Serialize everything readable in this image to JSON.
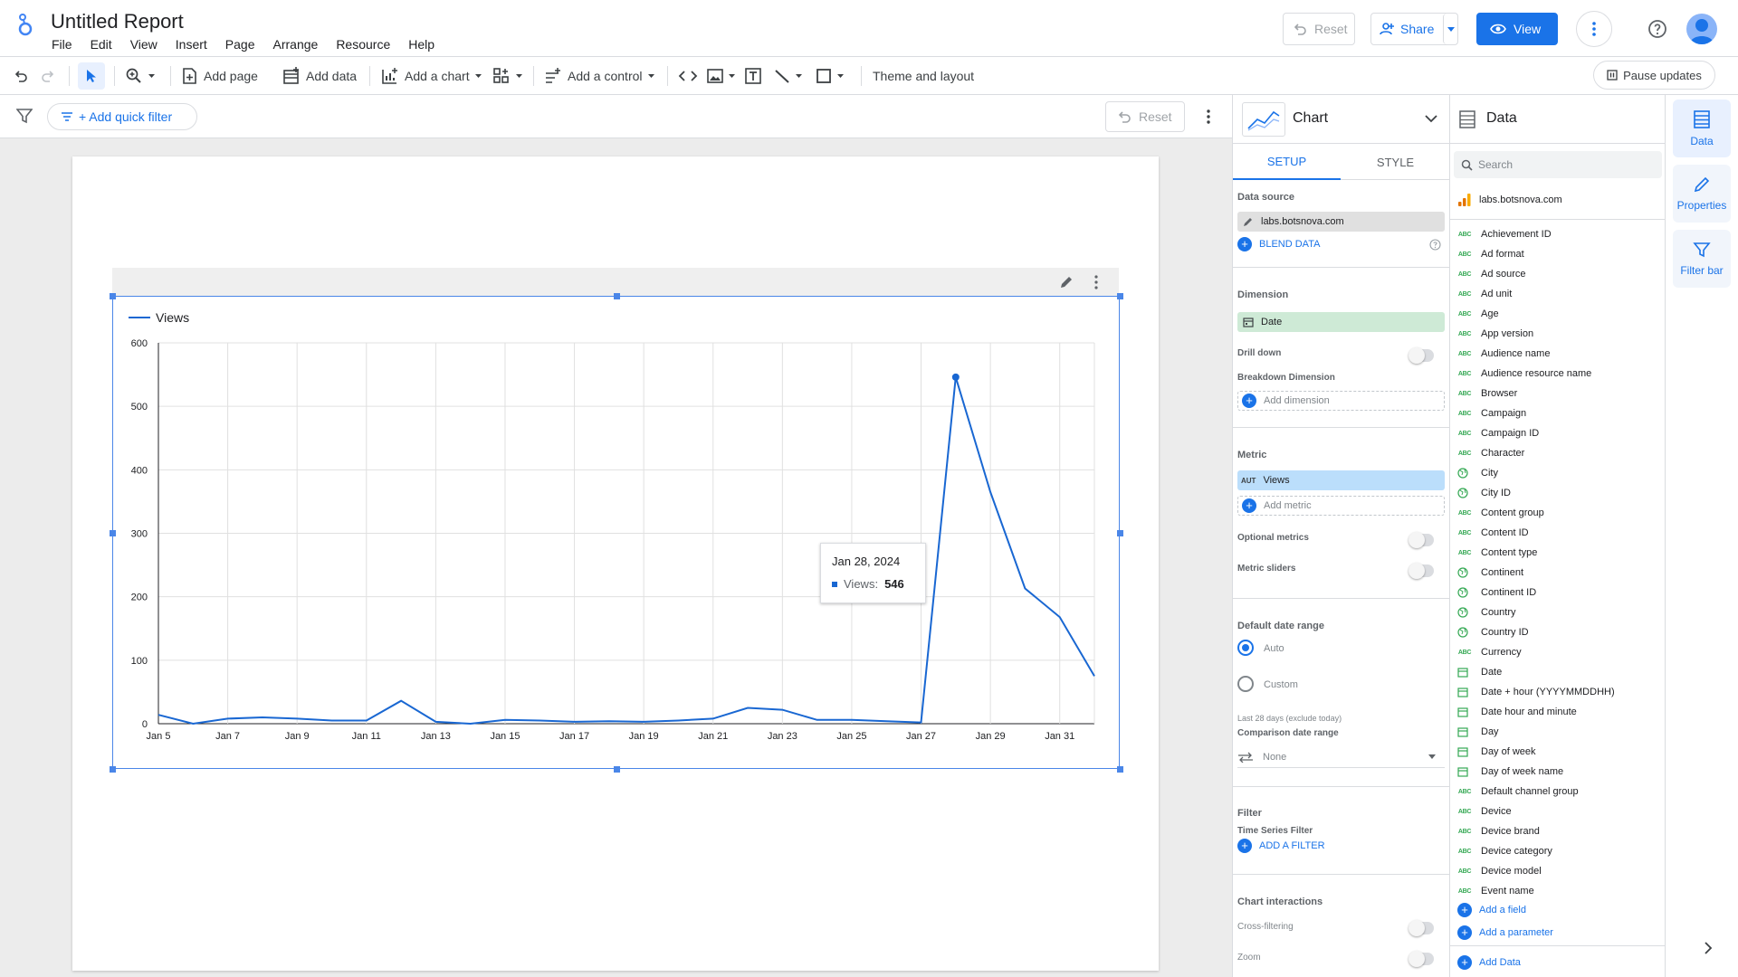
{
  "header": {
    "title": "Untitled Report",
    "menu": [
      "File",
      "Edit",
      "View",
      "Insert",
      "Page",
      "Arrange",
      "Resource",
      "Help"
    ],
    "reset_label": "Reset",
    "share_label": "Share",
    "view_label": "View"
  },
  "toolbar": {
    "add_page": "Add page",
    "add_data": "Add data",
    "add_chart": "Add a chart",
    "add_control": "Add a control",
    "theme_layout": "Theme and layout",
    "pause_updates": "Pause updates"
  },
  "filterbar": {
    "add_quick_filter": "+ Add quick filter",
    "reset_label": "Reset"
  },
  "chart_data": {
    "type": "line",
    "series": [
      {
        "name": "Views",
        "color": "#1967d2",
        "x": [
          "Jan 5",
          "Jan 6",
          "Jan 7",
          "Jan 8",
          "Jan 9",
          "Jan 10",
          "Jan 11",
          "Jan 12",
          "Jan 13",
          "Jan 14",
          "Jan 15",
          "Jan 16",
          "Jan 17",
          "Jan 18",
          "Jan 19",
          "Jan 20",
          "Jan 21",
          "Jan 22",
          "Jan 23",
          "Jan 24",
          "Jan 25",
          "Jan 26",
          "Jan 27",
          "Jan 28",
          "Jan 29",
          "Jan 30",
          "Jan 31",
          "Feb 1"
        ],
        "values": [
          14,
          0,
          8,
          10,
          8,
          5,
          5,
          36,
          3,
          0,
          6,
          5,
          3,
          4,
          3,
          5,
          8,
          25,
          22,
          6,
          6,
          4,
          2,
          546,
          365,
          213,
          168,
          75
        ]
      }
    ],
    "x_tick_labels": [
      "Jan 5",
      "Jan 7",
      "Jan 9",
      "Jan 11",
      "Jan 13",
      "Jan 15",
      "Jan 17",
      "Jan 19",
      "Jan 21",
      "Jan 23",
      "Jan 25",
      "Jan 27",
      "Jan 29",
      "Jan 31"
    ],
    "y_ticks": [
      0,
      100,
      200,
      300,
      400,
      500,
      600
    ],
    "ylim": [
      0,
      600
    ],
    "grid": true,
    "legend": "top-left",
    "highlight_index": 23
  },
  "tooltip": {
    "date": "Jan 28, 2024",
    "label": "Views:",
    "value": "546"
  },
  "props": {
    "chart_type": "Chart",
    "tab_setup": "SETUP",
    "tab_style": "STYLE",
    "data_source_label": "Data source",
    "data_source": "labs.botsnova.com",
    "blend_data": "BLEND DATA",
    "dimension_label": "Dimension",
    "dimension": "Date",
    "drill_down": "Drill down",
    "breakdown_label": "Breakdown Dimension",
    "add_dimension": "Add dimension",
    "metric_label": "Metric",
    "metric_tag": "AUT",
    "metric": "Views",
    "add_metric": "Add metric",
    "optional_metrics": "Optional metrics",
    "metric_sliders": "Metric sliders",
    "date_range_label": "Default date range",
    "auto": "Auto",
    "custom": "Custom",
    "last_28": "Last 28 days (exclude today)",
    "comparison_label": "Comparison date range",
    "comparison_value": "None",
    "filter_label": "Filter",
    "ts_filter": "Time Series Filter",
    "add_filter": "ADD A FILTER",
    "interactions_label": "Chart interactions",
    "cross_filtering": "Cross-filtering",
    "zoom": "Zoom"
  },
  "data_panel": {
    "title": "Data",
    "search_placeholder": "Search",
    "source": "labs.botsnova.com",
    "fields": [
      {
        "name": "Achievement ID",
        "icon": "abc"
      },
      {
        "name": "Ad format",
        "icon": "abc"
      },
      {
        "name": "Ad source",
        "icon": "abc"
      },
      {
        "name": "Ad unit",
        "icon": "abc"
      },
      {
        "name": "Age",
        "icon": "abc"
      },
      {
        "name": "App version",
        "icon": "abc"
      },
      {
        "name": "Audience name",
        "icon": "abc"
      },
      {
        "name": "Audience resource name",
        "icon": "abc"
      },
      {
        "name": "Browser",
        "icon": "abc"
      },
      {
        "name": "Campaign",
        "icon": "abc"
      },
      {
        "name": "Campaign ID",
        "icon": "abc"
      },
      {
        "name": "Character",
        "icon": "abc"
      },
      {
        "name": "City",
        "icon": "globe"
      },
      {
        "name": "City ID",
        "icon": "globe"
      },
      {
        "name": "Content group",
        "icon": "abc"
      },
      {
        "name": "Content ID",
        "icon": "abc"
      },
      {
        "name": "Content type",
        "icon": "abc"
      },
      {
        "name": "Continent",
        "icon": "globe"
      },
      {
        "name": "Continent ID",
        "icon": "globe"
      },
      {
        "name": "Country",
        "icon": "globe"
      },
      {
        "name": "Country ID",
        "icon": "globe"
      },
      {
        "name": "Currency",
        "icon": "abc"
      },
      {
        "name": "Date",
        "icon": "calendar"
      },
      {
        "name": "Date + hour (YYYYMMDDHH)",
        "icon": "calendar"
      },
      {
        "name": "Date hour and minute",
        "icon": "calendar"
      },
      {
        "name": "Day",
        "icon": "calendar"
      },
      {
        "name": "Day of week",
        "icon": "calendar"
      },
      {
        "name": "Day of week name",
        "icon": "calendar"
      },
      {
        "name": "Default channel group",
        "icon": "abc"
      },
      {
        "name": "Device",
        "icon": "abc"
      },
      {
        "name": "Device brand",
        "icon": "abc"
      },
      {
        "name": "Device category",
        "icon": "abc"
      },
      {
        "name": "Device model",
        "icon": "abc"
      },
      {
        "name": "Event name",
        "icon": "abc"
      }
    ],
    "add_field": "Add a field",
    "add_parameter": "Add a parameter",
    "add_data": "Add Data"
  },
  "rail": {
    "data": "Data",
    "properties": "Properties",
    "filter_bar": "Filter bar"
  }
}
